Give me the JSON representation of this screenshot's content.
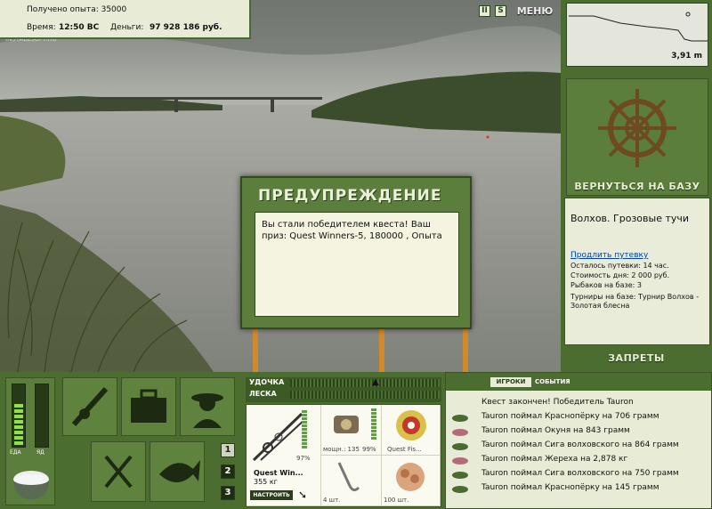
{
  "topbar": {
    "xp": "Получено опыта: 35000",
    "time_label": "Время:",
    "time": "12:50 ВС",
    "money_label": "Деньги:",
    "money": "97 928 186 руб.",
    "watermark": "INSTALLSOFT.RU"
  },
  "header": {
    "pause": "II",
    "sound": "S",
    "menu": "МЕНЮ"
  },
  "depth": {
    "value": "3,91 m"
  },
  "right": {
    "return_label": "ВЕРНУТЬСЯ НА БАЗУ",
    "bans_label": "ЗАПРЕТЫ"
  },
  "info": {
    "location": "Волхов. Грозовые тучи",
    "extend": "Продлить путевку",
    "left": "Осталось путевки: 14 час.",
    "cost": "Стоимость дня: 2 000 руб.",
    "anglers": "Рыбаков на базе: 3",
    "tourn": "Турниры на базе: Турнир Волхов - Золотая блесна"
  },
  "dialog": {
    "title": "ПРЕДУПРЕЖДЕНИЕ",
    "message": "Вы стали победителем квеста! Ваш приз: Quest Winners-5, 180000 , Опыта"
  },
  "status": {
    "food": "ЕДА",
    "poison": "ЯД"
  },
  "controls": {
    "rod": "УДОЧКА",
    "line": "ЛЕСКА"
  },
  "tackle": {
    "rod_name": "Quest Win...",
    "rod_weight": "355 кг",
    "rod_pct": "97%",
    "setup": "НАСТРОИТЬ",
    "reel_power": "мощн.: 135",
    "reel_pct": "99%",
    "line_name": "Quest Fis...",
    "hook_count": "4 шт.",
    "bait_count": "100 шт."
  },
  "pages": [
    "1",
    "2",
    "3"
  ],
  "log": {
    "tab_players": "ИГРОКИ",
    "tab_events": "СОБЫТИЯ",
    "lines": [
      "Квест закончен! Победитель Tauron",
      "Tauron поймал Краснопёрку на 706 грамм",
      "Tauron поймал Окуня на 843 грамм",
      "Tauron поймал Сига волховского на 864 грамм",
      "Tauron поймал Жереха на 2,878 кг",
      "Tauron поймал Сига волховского на 750 грамм",
      "Tauron поймал Краснопёрку на 145 грамм"
    ]
  },
  "colors": {
    "panel": "#4b6d30",
    "panel_light": "#5c7e3c",
    "paper": "#e8ecd6"
  }
}
